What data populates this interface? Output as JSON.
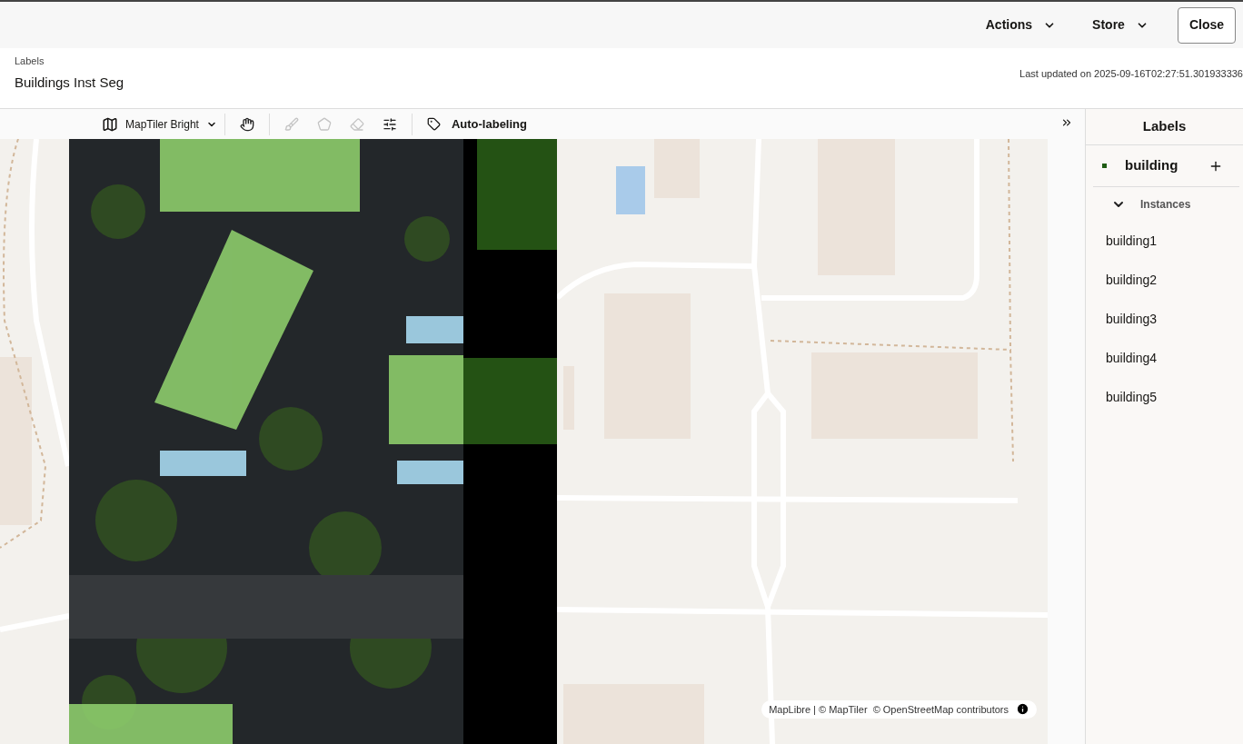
{
  "top_bar": {
    "menus": [
      {
        "label": "Actions"
      },
      {
        "label": "Store"
      }
    ],
    "close_button": "Close"
  },
  "header": {
    "breadcrumb": "Labels",
    "title": "Buildings Inst Seg",
    "last_updated": "Last updated on 2025-09-16T02:27:51.301933336"
  },
  "toolbar": {
    "basemap": "MapTiler Bright",
    "tools": [
      {
        "kind": "hand",
        "disabled": false
      },
      {
        "kind": "brush",
        "disabled": true
      },
      {
        "kind": "polygon",
        "disabled": true
      },
      {
        "kind": "eraser",
        "disabled": true
      },
      {
        "kind": "sliders",
        "disabled": false
      }
    ],
    "auto_labeling": "Auto-labeling"
  },
  "map": {
    "attribution": "MapLibre | © MapTiler  © OpenStreetMap contributors"
  },
  "labels_panel": {
    "title": "Labels",
    "labels": [
      {
        "name": "building",
        "color": "#1f5c14",
        "expanded": true,
        "instances_heading": "Instances",
        "instances": [
          "building1",
          "building2",
          "building3",
          "building4",
          "building5"
        ]
      }
    ]
  }
}
